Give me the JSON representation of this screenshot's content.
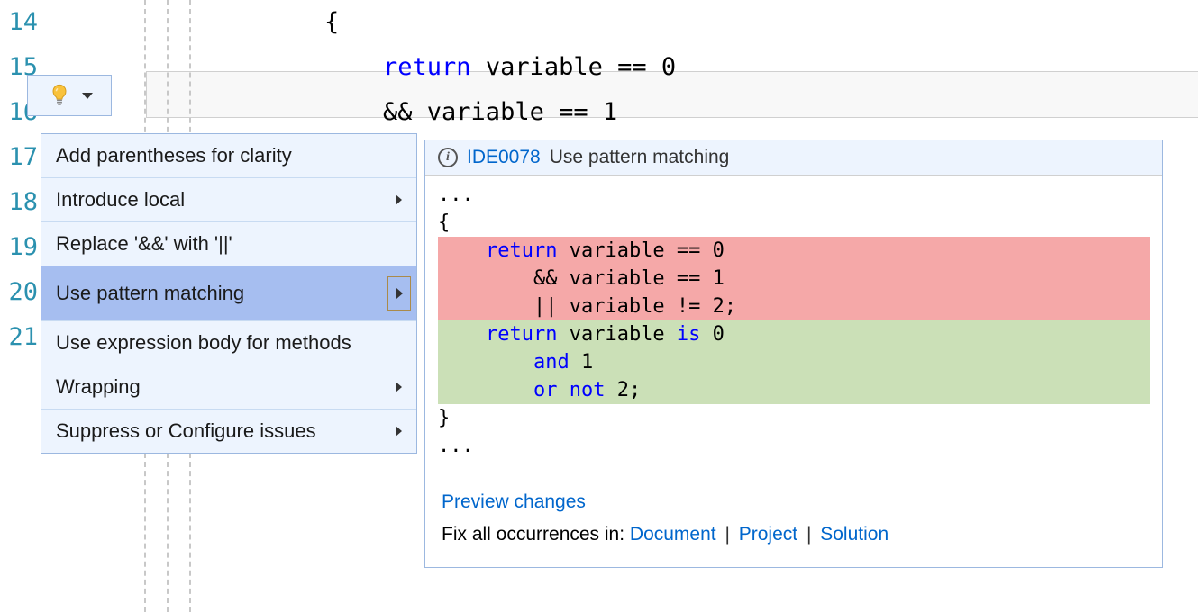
{
  "gutter": {
    "lines": [
      "14",
      "15",
      "16",
      "17",
      "18",
      "19",
      "20",
      "21"
    ]
  },
  "code": {
    "line1_brace": "{",
    "line2_return": "return",
    "line2_rest": " variable == 0",
    "line3": "    && variable == 1"
  },
  "menu": {
    "items": [
      {
        "label": "Add parentheses for clarity",
        "hasSub": false
      },
      {
        "label": "Introduce local",
        "hasSub": true
      },
      {
        "label": "Replace '&&' with '||'",
        "hasSub": false
      },
      {
        "label": "Use pattern matching",
        "hasSub": true,
        "selected": true
      },
      {
        "label": "Use expression body for methods",
        "hasSub": false
      },
      {
        "label": "Wrapping",
        "hasSub": true
      },
      {
        "label": "Suppress or Configure issues",
        "hasSub": true
      }
    ]
  },
  "preview": {
    "ruleId": "IDE0078",
    "ruleTitle": "Use pattern matching",
    "diff": {
      "pre1": "...",
      "pre2": "{",
      "rem1_kw": "return",
      "rem1_rest": " variable == 0",
      "rem2": "        && variable == 1",
      "rem3": "        || variable != 2;",
      "add1_kw": "return",
      "add1_rest": " variable ",
      "add1_is": "is",
      "add1_num": " 0",
      "add2_pad": "        ",
      "add2_and": "and",
      "add2_rest": " 1",
      "add3_pad": "        ",
      "add3_or": "or",
      "add3_not": " not",
      "add3_rest": " 2;",
      "post1": "}",
      "post2": "..."
    },
    "footer": {
      "previewLabel": "Preview changes",
      "fixLabel": "Fix all occurrences in: ",
      "doc": "Document",
      "proj": "Project",
      "sol": "Solution"
    }
  }
}
